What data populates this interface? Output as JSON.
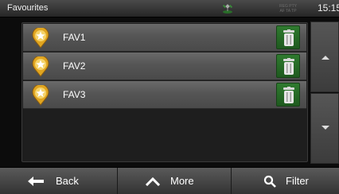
{
  "header": {
    "title": "Favourites",
    "tmc_lines": [
      "REG  PTY",
      "AF TA TP"
    ],
    "clock": "15:15",
    "gps_icon": "satellite-icon"
  },
  "list": {
    "items": [
      {
        "label": "FAV1",
        "icon": "favourite-star-icon",
        "action_icon": "trash-icon"
      },
      {
        "label": "FAV2",
        "icon": "favourite-star-icon",
        "action_icon": "trash-icon"
      },
      {
        "label": "FAV3",
        "icon": "favourite-star-icon",
        "action_icon": "trash-icon"
      }
    ]
  },
  "scroll": {
    "up_icon": "arrow-up-icon",
    "down_icon": "arrow-down-icon"
  },
  "toolbar": {
    "back_label": "Back",
    "more_label": "More",
    "filter_label": "Filter"
  },
  "colors": {
    "delete_green": "#2f7a2f",
    "star_yellow": "#f1b82a",
    "row_grey": "#5a5a5a"
  }
}
